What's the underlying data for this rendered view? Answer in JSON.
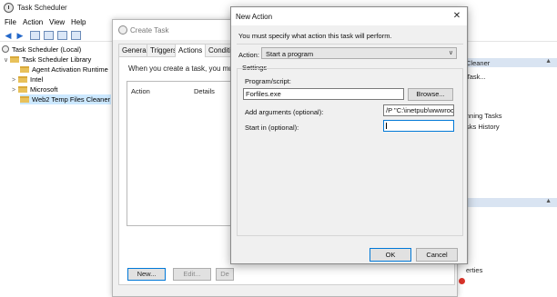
{
  "app": {
    "title": "Task Scheduler"
  },
  "menu": [
    "File",
    "Action",
    "View",
    "Help"
  ],
  "tree": {
    "root": "Task Scheduler (Local)",
    "library": "Task Scheduler Library",
    "folders": [
      "Agent Activation Runtime",
      "Intel",
      "Microsoft",
      "Web2 Temp Files Cleaner"
    ]
  },
  "actions_pane": {
    "header": "Cleaner",
    "items": [
      "Task...",
      "nning Tasks",
      "sks History"
    ],
    "footer": "erties",
    "collapse_icon": "caret-up-icon"
  },
  "create_task": {
    "title": "Create Task",
    "tabs": [
      "General",
      "Triggers",
      "Actions",
      "Condition"
    ],
    "active_tab": "Actions",
    "description": "When you create a task, you must sp",
    "columns": [
      "Action",
      "Details"
    ],
    "buttons": {
      "new": "New...",
      "edit": "Edit...",
      "delete": "De"
    }
  },
  "new_action": {
    "title": "New Action",
    "close_glyph": "✕",
    "description": "You must specify what action this task will perform.",
    "action_label": "Action:",
    "action_value": "Start a program",
    "settings_label": "Settings",
    "program_label": "Program/script:",
    "program_value": "Forfiles.exe",
    "browse_label": "Browse...",
    "args_label": "Add arguments (optional):",
    "args_value": "/P \"C:\\inetpub\\wwwroot",
    "start_label": "Start in (optional):",
    "start_value": "",
    "ok_label": "OK",
    "cancel_label": "Cancel"
  },
  "colors": {
    "accent": "#0078d7",
    "selection": "#cce8ff",
    "header_band": "#d9e4f2"
  }
}
